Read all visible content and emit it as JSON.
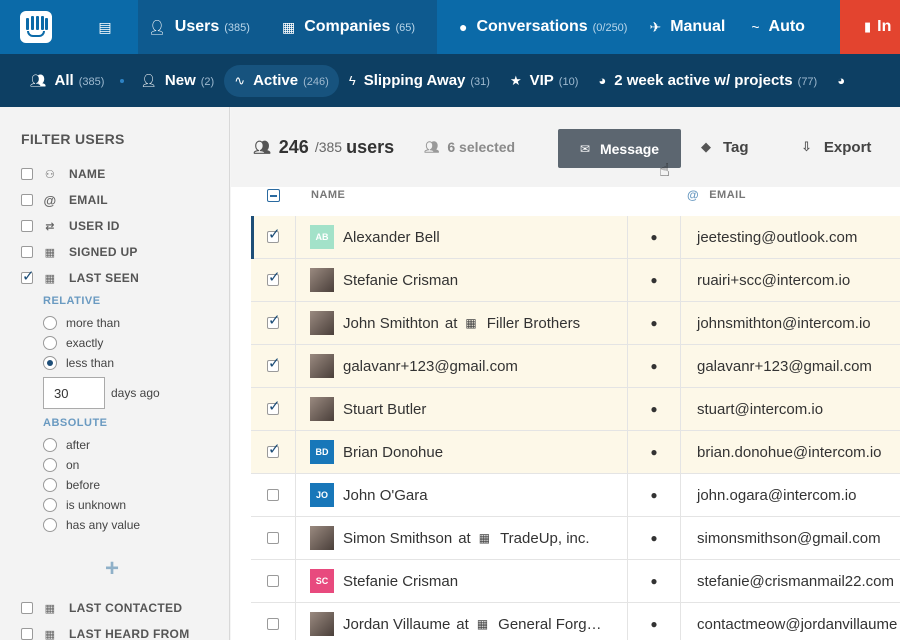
{
  "topnav": {
    "users": {
      "label": "Users",
      "count": "(385)"
    },
    "companies": {
      "label": "Companies",
      "count": "(65)"
    },
    "conversations": {
      "label": "Conversations",
      "count": "(0/250)"
    },
    "manual": {
      "label": "Manual"
    },
    "auto": {
      "label": "Auto"
    },
    "cut": {
      "label": "In"
    }
  },
  "segments": [
    {
      "label": "All",
      "count": "(385)",
      "icon": "users-icon"
    },
    {
      "label": "New",
      "count": "(2)",
      "icon": "user-icon"
    },
    {
      "label": "Active",
      "count": "(246)",
      "icon": "activity-icon"
    },
    {
      "label": "Slipping Away",
      "count": "(31)",
      "icon": "bolt-icon"
    },
    {
      "label": "VIP",
      "count": "(10)",
      "icon": "star-icon"
    },
    {
      "label": "2 week active w/ projects",
      "count": "(77)",
      "icon": "pie-icon"
    }
  ],
  "sidebar": {
    "title": "FILTER USERS",
    "filters": [
      {
        "label": "NAME",
        "checked": false
      },
      {
        "label": "EMAIL",
        "checked": false
      },
      {
        "label": "USER ID",
        "checked": false
      },
      {
        "label": "SIGNED UP",
        "checked": false
      },
      {
        "label": "LAST SEEN",
        "checked": true
      }
    ],
    "relative": {
      "heading": "RELATIVE",
      "options": [
        "more than",
        "exactly",
        "less than"
      ],
      "selected": "less than"
    },
    "days_value": "30",
    "days_suffix": "days ago",
    "absolute": {
      "heading": "ABSOLUTE",
      "options": [
        "after",
        "on",
        "before",
        "is unknown",
        "has any value"
      ]
    },
    "add_symbol": "+",
    "more_filters": [
      {
        "label": "LAST CONTACTED",
        "checked": false
      },
      {
        "label": "LAST HEARD FROM",
        "checked": false
      }
    ]
  },
  "toolbar": {
    "count": "246",
    "total": "/385",
    "unit": "users",
    "selected": "6 selected",
    "message_label": "Message",
    "tag_label": "Tag",
    "export_label": "Export"
  },
  "table": {
    "headers": {
      "name": "NAME",
      "email": "EMAIL"
    },
    "rows": [
      {
        "name": "Alexander Bell",
        "initials": "AB",
        "avatar_color": "#a3e2c9",
        "email": "jeetesting@outlook.com",
        "selected": true
      },
      {
        "name": "Stefanie Crisman",
        "photo": true,
        "email": "ruairi+scc@intercom.io",
        "selected": true
      },
      {
        "name": "John Smithton",
        "at": "at",
        "company": "Filler Brothers",
        "photo": true,
        "email": "johnsmithton@intercom.io",
        "selected": true
      },
      {
        "name": "galavanr+123@gmail.com",
        "photo": true,
        "email": "galavanr+123@gmail.com",
        "selected": true
      },
      {
        "name": "Stuart Butler",
        "photo": true,
        "email": "stuart@intercom.io",
        "selected": true
      },
      {
        "name": "Brian Donohue",
        "initials": "BD",
        "avatar_color": "#1877b9",
        "email": "brian.donohue@intercom.io",
        "selected": true
      },
      {
        "name": "John O'Gara",
        "initials": "JO",
        "avatar_color": "#1877b9",
        "email": "john.ogara@intercom.io",
        "selected": false
      },
      {
        "name": "Simon Smithson",
        "at": "at",
        "company": "TradeUp, inc.",
        "photo": true,
        "email": "simonsmithson@gmail.com",
        "selected": false
      },
      {
        "name": "Stefanie Crisman",
        "initials": "SC",
        "avatar_color": "#e84a7e",
        "email": "stefanie@crismanmail22.com",
        "selected": false
      },
      {
        "name": "Jordan Villaume",
        "at": "at",
        "company": "General Forg…",
        "photo": true,
        "email": "contactmeow@jordanvillaume",
        "selected": false
      }
    ]
  }
}
